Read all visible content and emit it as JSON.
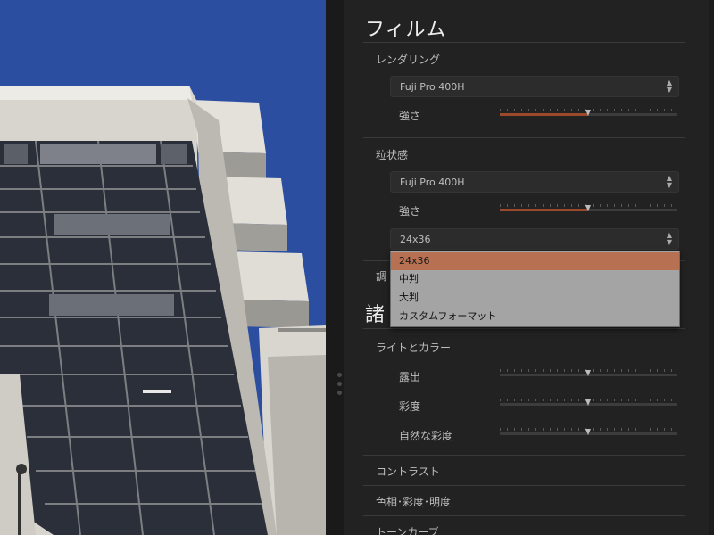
{
  "panel": {
    "film_section": {
      "title": "フィルム",
      "rendering": {
        "title": "レンダリング",
        "preset": "Fuji Pro 400H",
        "strength_label": "強さ",
        "strength_value": 0.5
      },
      "grain": {
        "title": "粒状感",
        "preset": "Fuji Pro 400H",
        "strength_label": "強さ",
        "strength_value": 0.5,
        "format_value": "24x36"
      },
      "adjust_partial": "調"
    },
    "settings_section": {
      "title_partial": "諸",
      "light_color": {
        "title": "ライトとカラー",
        "sliders": [
          {
            "label": "露出",
            "value": 0.5
          },
          {
            "label": "彩度",
            "value": 0.5
          },
          {
            "label": "自然な彩度",
            "value": 0.5
          }
        ]
      },
      "contrast": "コントラスト",
      "hsl": "色相･彩度･明度",
      "tone_curve": "トーンカーブ"
    }
  },
  "format_dropdown": {
    "options": [
      "24x36",
      "中判",
      "大判",
      "カスタムフォーマット"
    ],
    "selected_index": 0
  },
  "colors": {
    "accent_fill": "#9a4a2a",
    "dropdown_highlight": "#b87052",
    "sky": "#2b4ea0"
  }
}
